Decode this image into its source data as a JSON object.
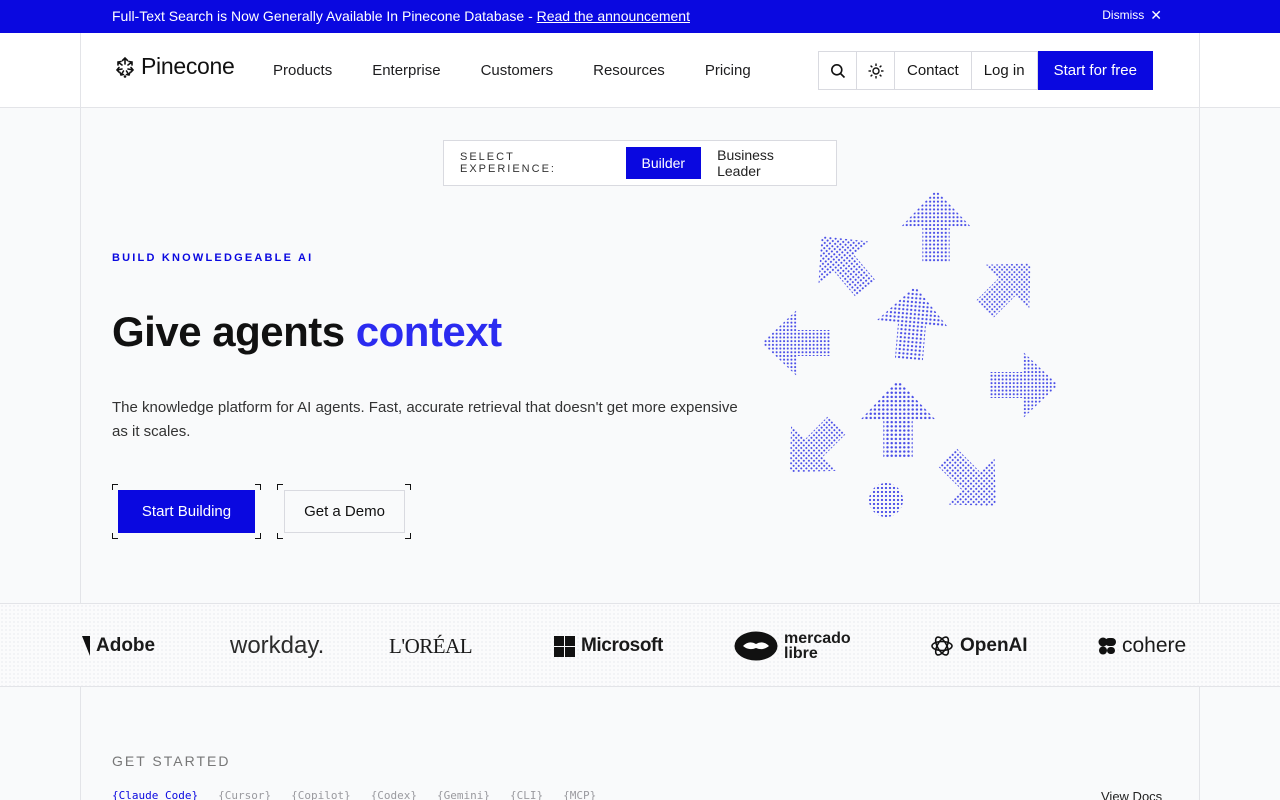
{
  "announcement": {
    "message": "Full-Text Search is Now Generally Available In Pinecone Database - ",
    "link": "Read the announcement",
    "dismiss": "Dismiss"
  },
  "header": {
    "brand": "Pinecone",
    "nav": [
      "Products",
      "Enterprise",
      "Customers",
      "Resources",
      "Pricing"
    ],
    "contact": "Contact",
    "login": "Log in",
    "cta": "Start for free"
  },
  "experience": {
    "label": "SELECT EXPERIENCE:",
    "options": [
      "Builder",
      "Business Leader"
    ],
    "selected": "Builder"
  },
  "hero": {
    "eyebrow": "BUILD KNOWLEDGEABLE AI",
    "headline_plain": "Give agents ",
    "headline_accent": "context",
    "subtext": "The knowledge platform for AI agents. Fast, accurate retrieval that doesn't get more expensive as it scales.",
    "primary": "Start Building",
    "secondary": "Get a Demo"
  },
  "logos": [
    "Adobe",
    "workday.",
    "L'ORÉAL",
    "Microsoft",
    "mercado",
    "libre",
    "OpenAI",
    "cohere"
  ],
  "get_started": {
    "title": "GET STARTED",
    "tabs": [
      "{Claude Code}",
      "{Cursor}",
      "{Copilot}",
      "{Codex}",
      "{Gemini}",
      "{CLI}",
      "{MCP}"
    ],
    "active_tab": "{Claude Code}",
    "view_docs": "View Docs"
  },
  "colors": {
    "brand_blue": "#0a08e0",
    "accent_blue": "#2b2bf0"
  }
}
